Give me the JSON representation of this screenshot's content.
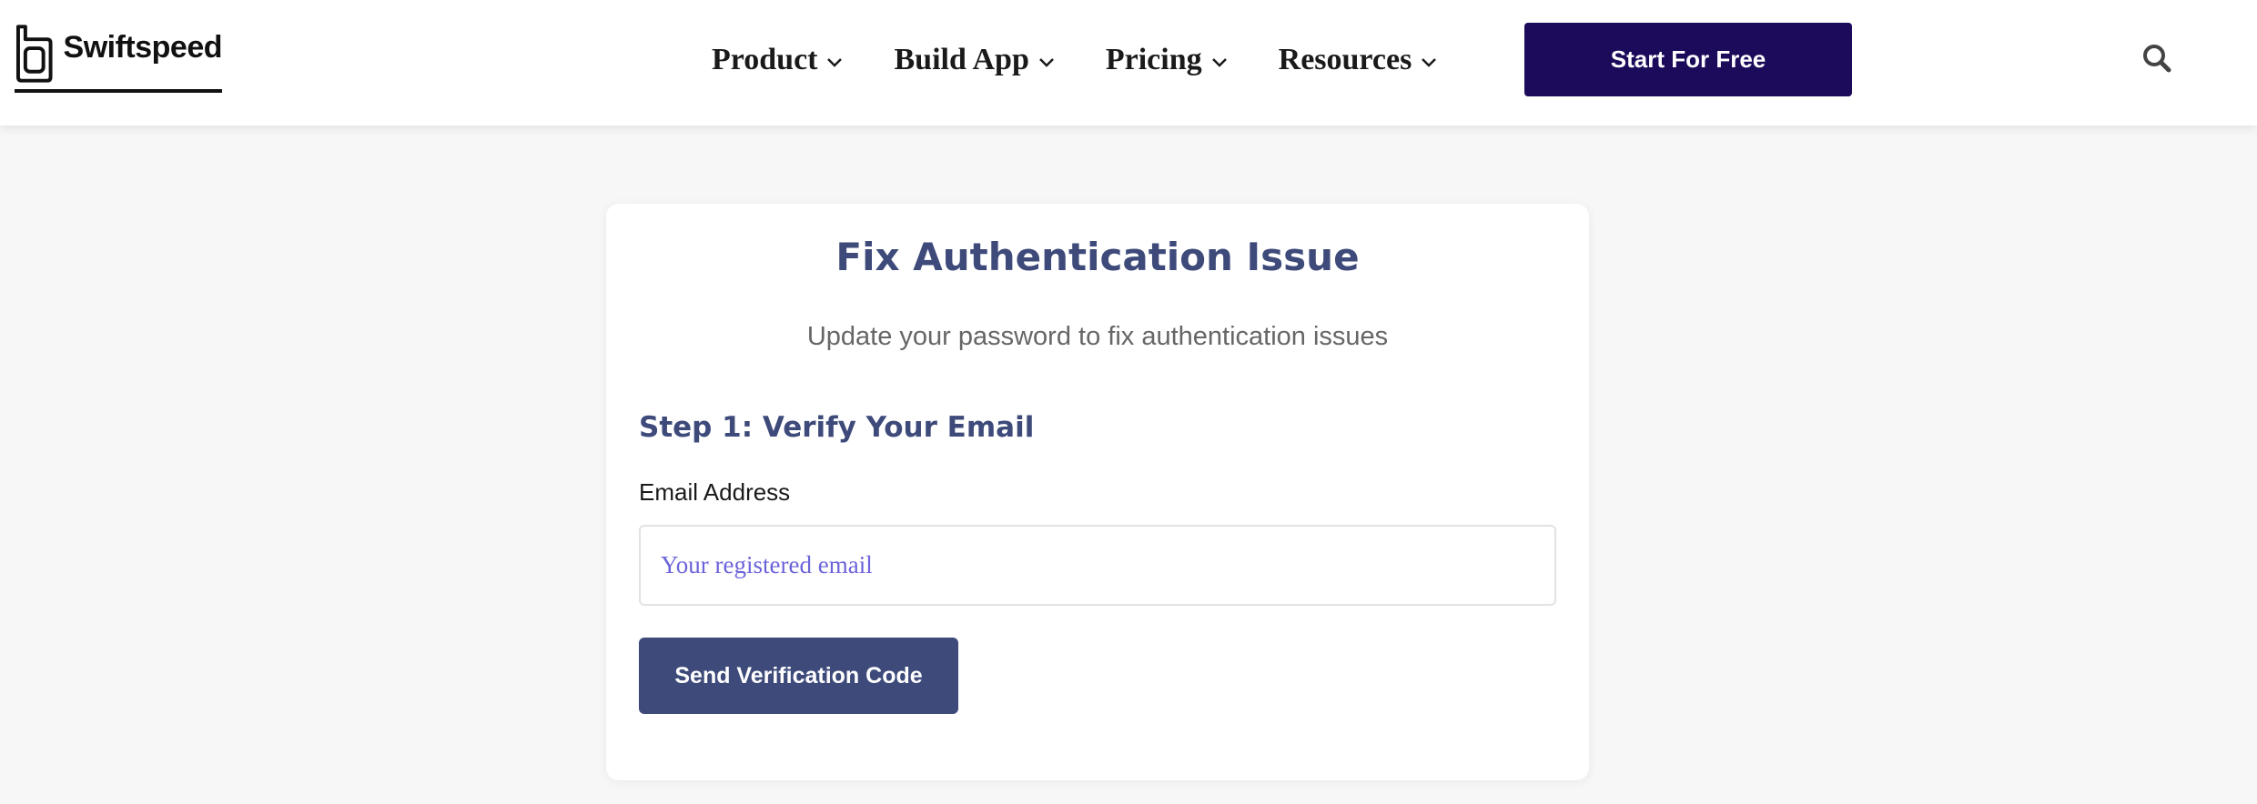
{
  "header": {
    "logo": {
      "text": "Swiftspeed",
      "icon": "swiftspeed-logo-icon"
    },
    "nav": {
      "items": [
        {
          "label": "Product",
          "icon": "chevron-down-icon"
        },
        {
          "label": "Build App",
          "icon": "chevron-down-icon"
        },
        {
          "label": "Pricing",
          "icon": "chevron-down-icon"
        },
        {
          "label": "Resources",
          "icon": "chevron-down-icon"
        }
      ]
    },
    "cta_label": "Start For Free",
    "search_icon": "search-icon"
  },
  "card": {
    "title": "Fix Authentication Issue",
    "subtitle": "Update your password to fix authentication issues",
    "step_title": "Step 1: Verify Your Email",
    "email_label": "Email Address",
    "email_value": "",
    "email_placeholder": "Your registered email",
    "send_button_label": "Send Verification Code"
  },
  "colors": {
    "primary": "#3d4a7a",
    "cta": "#1c0a5a",
    "placeholder": "#6b63d9",
    "background": "#f7f7f7"
  }
}
